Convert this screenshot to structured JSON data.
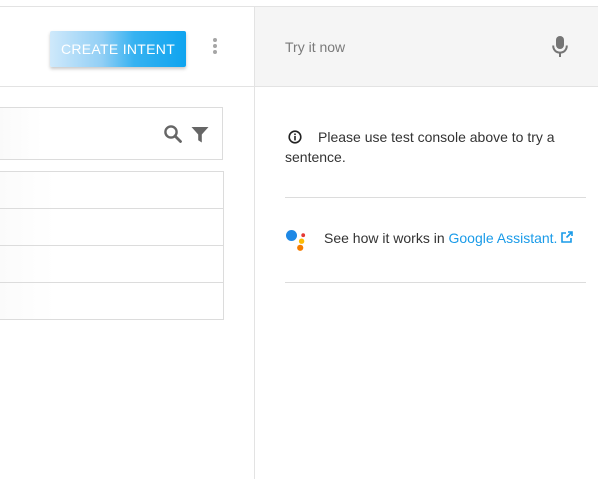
{
  "header": {
    "create_intent_label": "CREATE INTENT",
    "more_icon": "more-vert-icon"
  },
  "search": {
    "icon": "search-icon",
    "filter_icon": "filter-icon"
  },
  "intent_list": {
    "rows": [
      "",
      "",
      "",
      ""
    ]
  },
  "test_console": {
    "placeholder": "Try it now",
    "mic_icon": "microphone-icon"
  },
  "console_note": {
    "icon": "info-icon",
    "text": "Please use test console above to try a sentence."
  },
  "assistant": {
    "prefix": "See how it works in ",
    "link_label": "Google Assistant.",
    "icon": "google-assistant-icon",
    "external_icon": "external-link-icon"
  },
  "colors": {
    "accent": "#0fa4ef",
    "link": "#1a9be8",
    "assistant_blue": "#4285f4",
    "assistant_red": "#ea4335",
    "assistant_yellow": "#fbbc05",
    "assistant_green": "#34a853"
  }
}
